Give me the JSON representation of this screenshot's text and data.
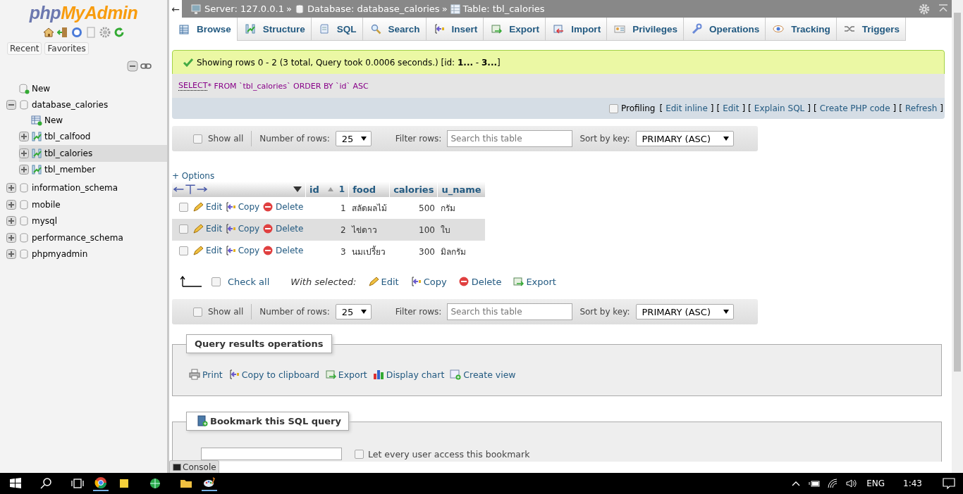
{
  "sidebar": {
    "logo": {
      "part_1": "php",
      "part_2": "MyAdmin"
    },
    "buttons": [
      "Recent",
      "Favorites"
    ],
    "tree": [
      {
        "label": "New",
        "kind": "new"
      },
      {
        "label": "database_calories",
        "kind": "database",
        "expanded": true,
        "children": [
          {
            "label": "New",
            "kind": "new_table"
          },
          {
            "label": "tbl_calfood",
            "kind": "table",
            "expanded": false,
            "selected": false
          },
          {
            "label": "tbl_calories",
            "kind": "table",
            "expanded": false,
            "selected": true
          },
          {
            "label": "tbl_member",
            "kind": "table",
            "expanded": false,
            "selected": false
          }
        ]
      },
      {
        "label": "information_schema",
        "kind": "database",
        "expanded": false
      },
      {
        "label": "mobile",
        "kind": "database",
        "expanded": false
      },
      {
        "label": "mysql",
        "kind": "database",
        "expanded": false
      },
      {
        "label": "performance_schema",
        "kind": "database",
        "expanded": false
      },
      {
        "label": "phpmyadmin",
        "kind": "database",
        "expanded": false
      }
    ]
  },
  "breadcrumb": {
    "back": "←",
    "separator": "»",
    "items": [
      {
        "kind": "server",
        "label": "Server: 127.0.0.1"
      },
      {
        "kind": "database",
        "label": "Database: database_calories"
      },
      {
        "kind": "table",
        "label": "Table: tbl_calories"
      }
    ]
  },
  "tabs": [
    {
      "label": "Browse",
      "selected": true
    },
    {
      "label": "Structure",
      "selected": false
    },
    {
      "label": "SQL",
      "selected": false
    },
    {
      "label": "Search",
      "selected": false
    },
    {
      "label": "Insert",
      "selected": false
    },
    {
      "label": "Export",
      "selected": false
    },
    {
      "label": "Import",
      "selected": false
    },
    {
      "label": "Privileges",
      "selected": false
    },
    {
      "label": "Operations",
      "selected": false
    },
    {
      "label": "Tracking",
      "selected": false
    },
    {
      "label": "Triggers",
      "selected": false
    }
  ],
  "message": "Showing rows 0 - 2 (3 total, Query took 0.0006 seconds.) [id: **1...** - **3...**]",
  "sql": {
    "keyword": "SELECT",
    "rest": "* FROM `tbl_calories` ORDER BY `id` ASC"
  },
  "profiling": {
    "checked": false,
    "label": "Profiling",
    "open": "[",
    "close": "]",
    "links": [
      "Edit inline",
      "Edit",
      "Explain SQL",
      "Create PHP code",
      "Refresh"
    ]
  },
  "navigation_top": {
    "show_all": "Show all",
    "show_all_checked": false,
    "rows_label": "Number of rows:",
    "rows_value": "25",
    "filter_label": "Filter rows:",
    "filter_placeholder": "Search this table",
    "sort_label": "Sort by key:",
    "sort_value": "PRIMARY (ASC)"
  },
  "options": "+ Options",
  "table": {
    "columns": [
      {
        "label": "id",
        "sort_order": "1"
      },
      {
        "label": "food"
      },
      {
        "label": "calories"
      },
      {
        "label": "u_name"
      }
    ],
    "rows": [
      {
        "checked": false,
        "actions": [
          "Edit",
          "Copy",
          "Delete"
        ],
        "cells": [
          "1",
          "สลัดผลไม้",
          "500",
          "กรัม"
        ]
      },
      {
        "checked": false,
        "actions": [
          "Edit",
          "Copy",
          "Delete"
        ],
        "cells": [
          "2",
          "ไข่ดาว",
          "100",
          "ใบ"
        ]
      },
      {
        "checked": false,
        "actions": [
          "Edit",
          "Copy",
          "Delete"
        ],
        "cells": [
          "3",
          "นมเปรี้ยว",
          "300",
          "มิลกรัม"
        ]
      }
    ]
  },
  "bulk": {
    "check_all": "Check all",
    "checked": false,
    "with_selected": "With selected:",
    "actions": [
      "Edit",
      "Copy",
      "Delete",
      "Export"
    ]
  },
  "navigation_bottom": {
    "show_all": "Show all",
    "show_all_checked": false,
    "rows_label": "Number of rows:",
    "rows_value": "25",
    "filter_label": "Filter rows:",
    "filter_placeholder": "Search this table",
    "sort_label": "Sort by key:",
    "sort_value": "PRIMARY (ASC)"
  },
  "query_operations": {
    "legend": "Query results operations",
    "items": [
      "Print",
      "Copy to clipboard",
      "Export",
      "Display chart",
      "Create view"
    ]
  },
  "bookmark": {
    "legend": "Bookmark this SQL query",
    "shared_label": "Let every user access this bookmark",
    "shared_checked": false
  },
  "console": "Console",
  "taskbar": {
    "language": "ENG",
    "time": "1:43"
  }
}
